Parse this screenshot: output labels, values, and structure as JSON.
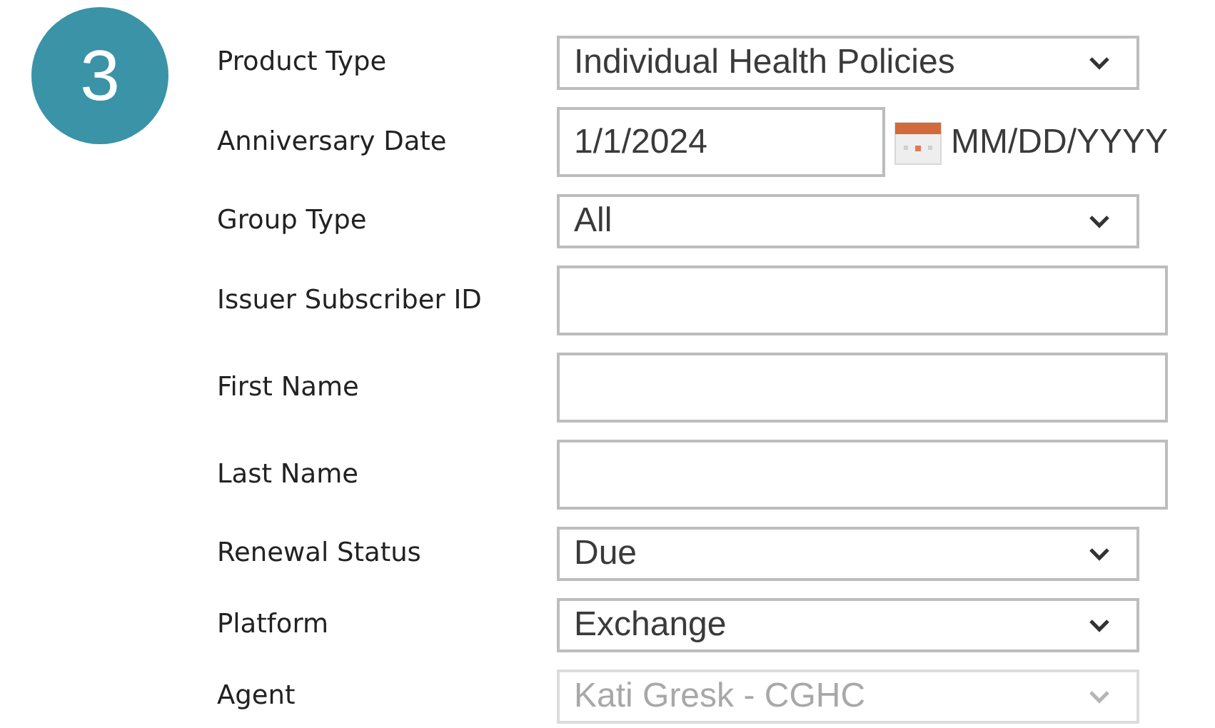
{
  "step_badge": "3",
  "fields": [
    {
      "kind": "select",
      "label": "Product Type",
      "value": "Individual Health Policies",
      "disabled": false
    },
    {
      "kind": "date",
      "label": "Anniversary Date",
      "value": "1/1/2024",
      "hint": "MM/DD/YYYY",
      "disabled": false
    },
    {
      "kind": "select",
      "label": "Group Type",
      "value": "All",
      "disabled": false
    },
    {
      "kind": "text",
      "label": "Issuer Subscriber ID",
      "disabled": false
    },
    {
      "kind": "text",
      "label": "First Name",
      "disabled": false
    },
    {
      "kind": "text",
      "label": "Last Name",
      "disabled": false
    },
    {
      "kind": "select",
      "label": "Renewal Status",
      "value": "Due",
      "disabled": false
    },
    {
      "kind": "select",
      "label": "Platform",
      "value": "Exchange",
      "disabled": false
    },
    {
      "kind": "select",
      "label": "Agent",
      "value": "Kati Gresk - CGHC",
      "disabled": true
    }
  ]
}
